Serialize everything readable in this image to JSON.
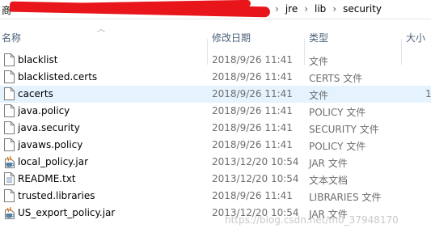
{
  "address_bar": {
    "first_char": "商",
    "breadcrumbs": [
      "jre",
      "lib",
      "security"
    ],
    "separator": "›"
  },
  "columns": {
    "name": "名称",
    "date": "修改日期",
    "type": "类型",
    "size": "大小"
  },
  "files": [
    {
      "name": "blacklist",
      "date": "2018/9/26 11:41",
      "type": "文件",
      "size": "",
      "icon": "file-icon"
    },
    {
      "name": "blacklisted.certs",
      "date": "2018/9/26 11:41",
      "type": "CERTS 文件",
      "size": "",
      "icon": "file-icon"
    },
    {
      "name": "cacerts",
      "date": "2018/9/26 11:41",
      "type": "文件",
      "size": "1",
      "icon": "file-icon",
      "selected": true
    },
    {
      "name": "java.policy",
      "date": "2018/9/26 11:41",
      "type": "POLICY 文件",
      "size": "",
      "icon": "file-icon"
    },
    {
      "name": "java.security",
      "date": "2018/9/26 11:41",
      "type": "SECURITY 文件",
      "size": "",
      "icon": "file-icon"
    },
    {
      "name": "javaws.policy",
      "date": "2018/9/26 11:41",
      "type": "POLICY 文件",
      "size": "",
      "icon": "file-icon"
    },
    {
      "name": "local_policy.jar",
      "date": "2013/12/20 10:54",
      "type": "JAR 文件",
      "size": "",
      "icon": "java-jar-icon"
    },
    {
      "name": "README.txt",
      "date": "2013/12/20 10:54",
      "type": "文本文档",
      "size": "",
      "icon": "text-file-icon"
    },
    {
      "name": "trusted.libraries",
      "date": "2018/9/26 11:41",
      "type": "LIBRARIES 文件",
      "size": "",
      "icon": "file-icon"
    },
    {
      "name": "US_export_policy.jar",
      "date": "2013/12/20 10:54",
      "type": "JAR 文件",
      "size": "",
      "icon": "java-jar-icon"
    }
  ],
  "watermark": "https://blog.csdn.net/m0_37948170"
}
